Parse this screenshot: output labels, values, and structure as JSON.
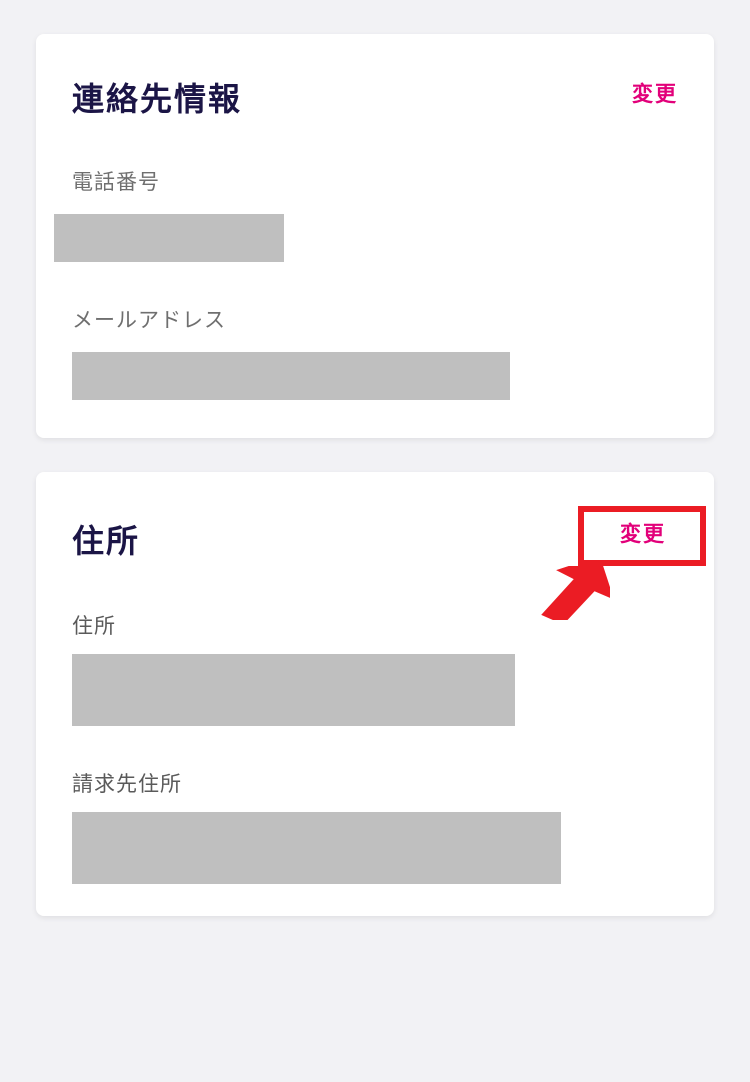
{
  "contact": {
    "title": "連絡先情報",
    "change_label": "変更",
    "phone_label": "電話番号",
    "email_label": "メールアドレス"
  },
  "address": {
    "title": "住所",
    "change_label": "変更",
    "address_label": "住所",
    "billing_label": "請求先住所"
  }
}
